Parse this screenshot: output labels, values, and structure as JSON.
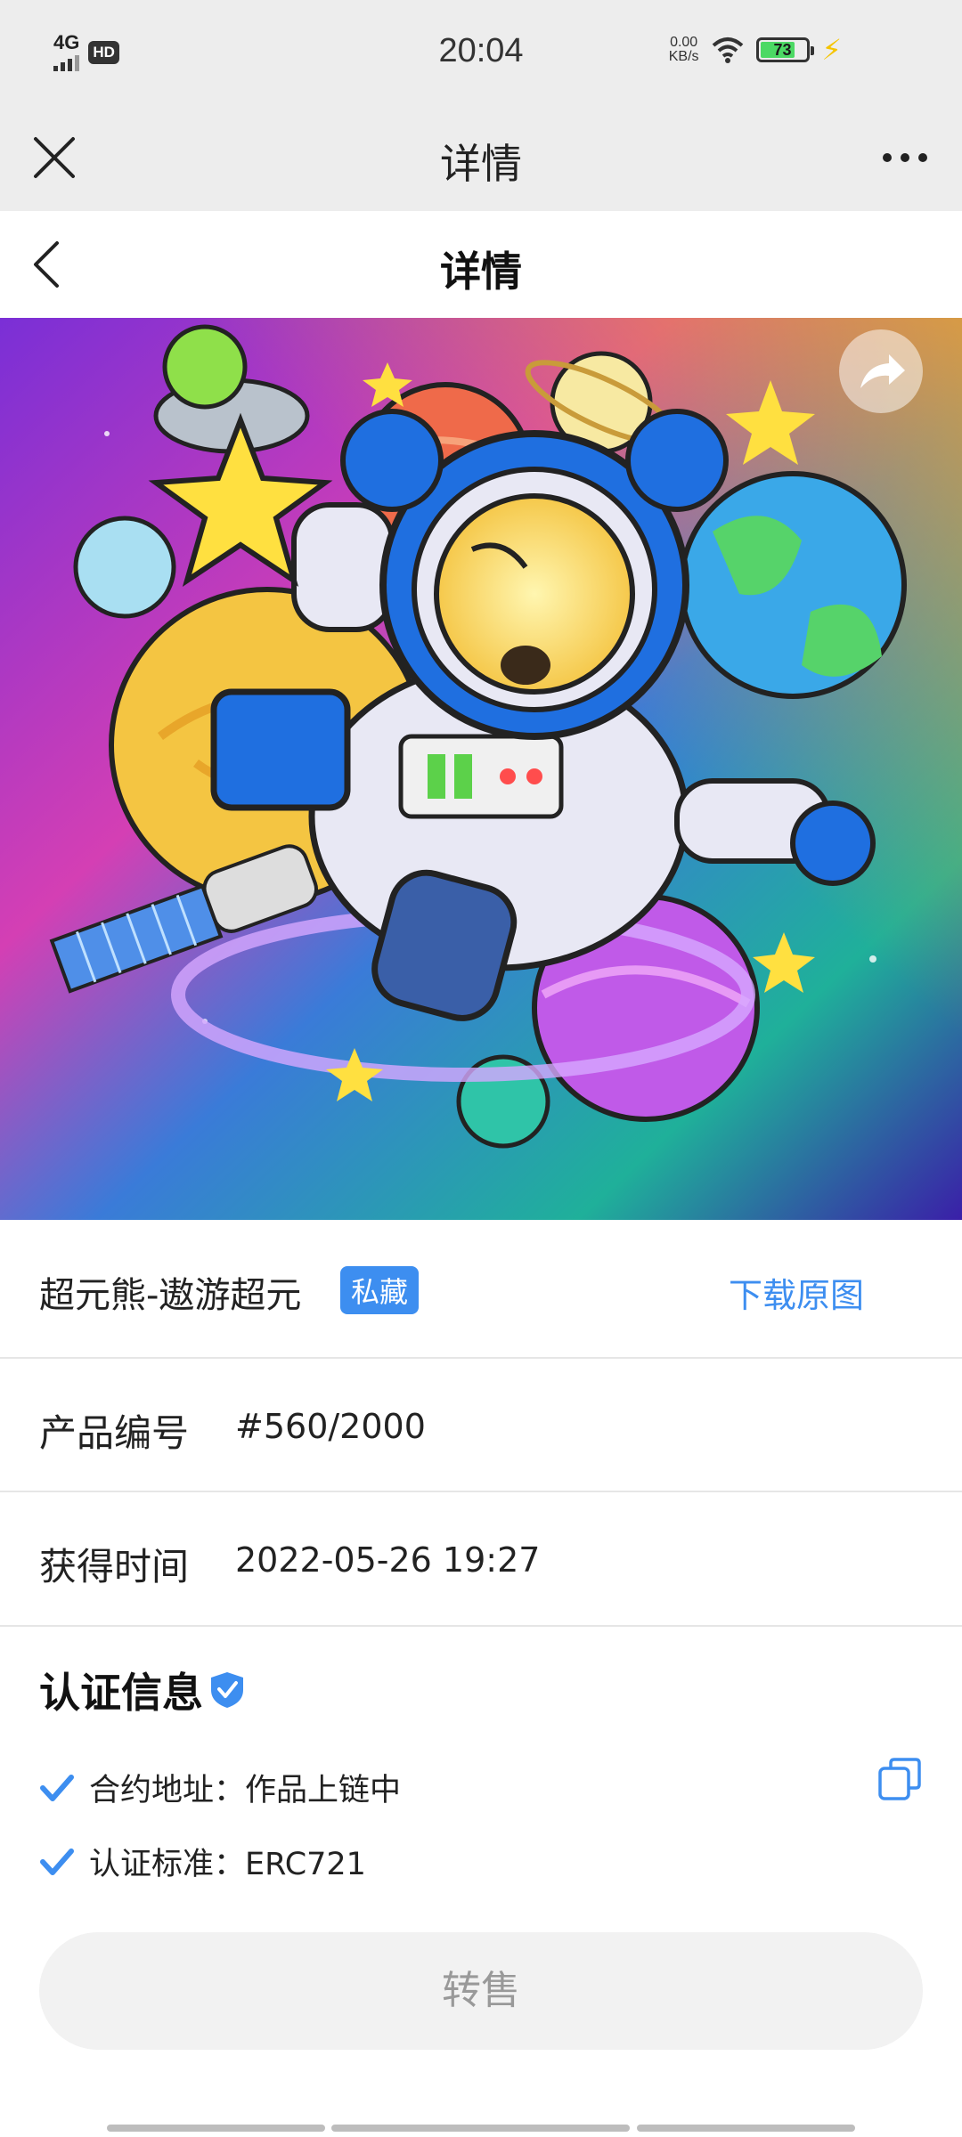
{
  "status_bar": {
    "network": "4G",
    "hd": "HD",
    "time": "20:04",
    "speed_value": "0.00",
    "speed_unit": "KB/s",
    "battery": "73"
  },
  "wechat_bar": {
    "title": "详情"
  },
  "header": {
    "title": "详情"
  },
  "item": {
    "name": "超元熊-遨游超元",
    "badge": "私藏",
    "download": "下载原图"
  },
  "details": {
    "serial_label": "产品编号",
    "serial_value": "#560/2000",
    "time_label": "获得时间",
    "time_value": "2022-05-26 19:27"
  },
  "cert": {
    "title": "认证信息",
    "contract_text": "合约地址：作品上链中",
    "standard_text": "认证标准：ERC721"
  },
  "actions": {
    "resell": "转售"
  },
  "colors": {
    "accent": "#3d8ef0",
    "badge_bg": "#3d8ef0"
  },
  "icons": [
    "close-icon",
    "more-icon",
    "back-icon",
    "share-icon",
    "shield-check-icon",
    "check-icon",
    "copy-icon"
  ]
}
